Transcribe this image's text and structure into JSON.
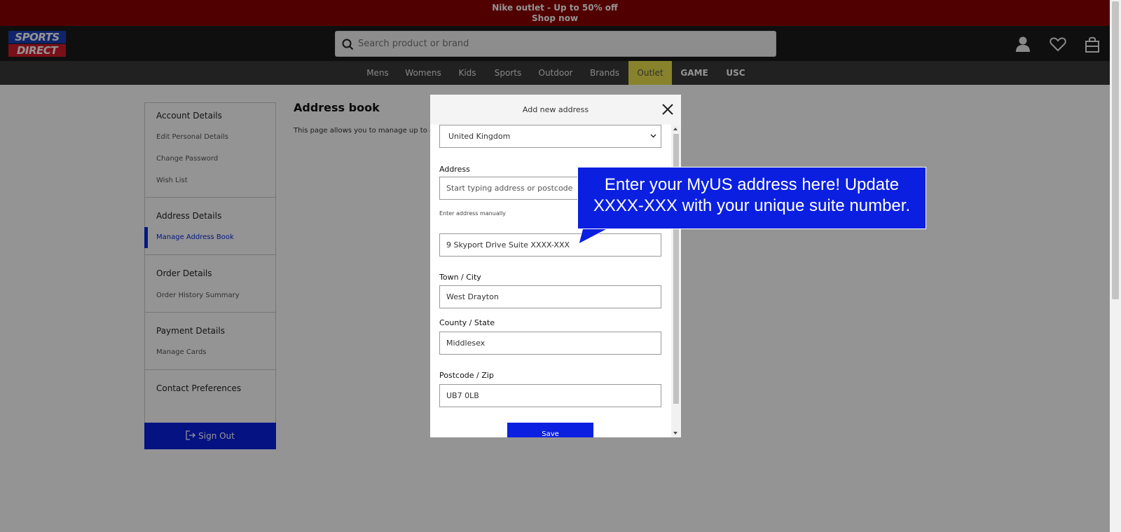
{
  "promo": {
    "line1": "Nike outlet - Up to 50% off",
    "line2": "Shop now"
  },
  "header": {
    "logo_line1": "SPORTS",
    "logo_line2": "DIRECT",
    "search_placeholder": "Search product or brand",
    "icons": [
      "account-icon",
      "wishlist-heart-icon",
      "shopping-bag-icon"
    ]
  },
  "nav": {
    "items": [
      "Mens",
      "Womens",
      "Kids",
      "Sports",
      "Outdoor",
      "Brands",
      "Outlet",
      "GAME",
      "USC"
    ],
    "highlight_color": "#e8e14a"
  },
  "sidebar": {
    "account_title": "Account Details",
    "account_links": [
      "Edit Personal Details",
      "Change Password",
      "Wish List"
    ],
    "address_title": "Address Details",
    "address_links": [
      "Manage Address Book"
    ],
    "order_title": "Order Details",
    "order_links": [
      "Order History Summary"
    ],
    "payment_title": "Payment Details",
    "payment_links": [
      "Manage Cards"
    ],
    "contact_title": "Contact Preferences",
    "signout": "Sign Out"
  },
  "main": {
    "title": "Address book",
    "description": "This page allows you to manage up to a"
  },
  "modal": {
    "title": "Add new address",
    "country_value": "United Kingdom",
    "address_label": "Address",
    "address_placeholder": "Start typing address or postcode",
    "enter_manually": "Enter address manually",
    "address_line_value": "9 Skyport Drive Suite XXXX-XXX",
    "town_label": "Town / City",
    "town_value": "West Drayton",
    "county_label": "County / State",
    "county_value": "Middlesex",
    "postcode_label": "Postcode / Zip",
    "postcode_value": "UB7 0LB",
    "save": "Save"
  },
  "callout": {
    "line1": "Enter your MyUS address here! Update",
    "line2": "XXXX-XXX with your unique suite number.",
    "color": "#0a1fe0"
  }
}
